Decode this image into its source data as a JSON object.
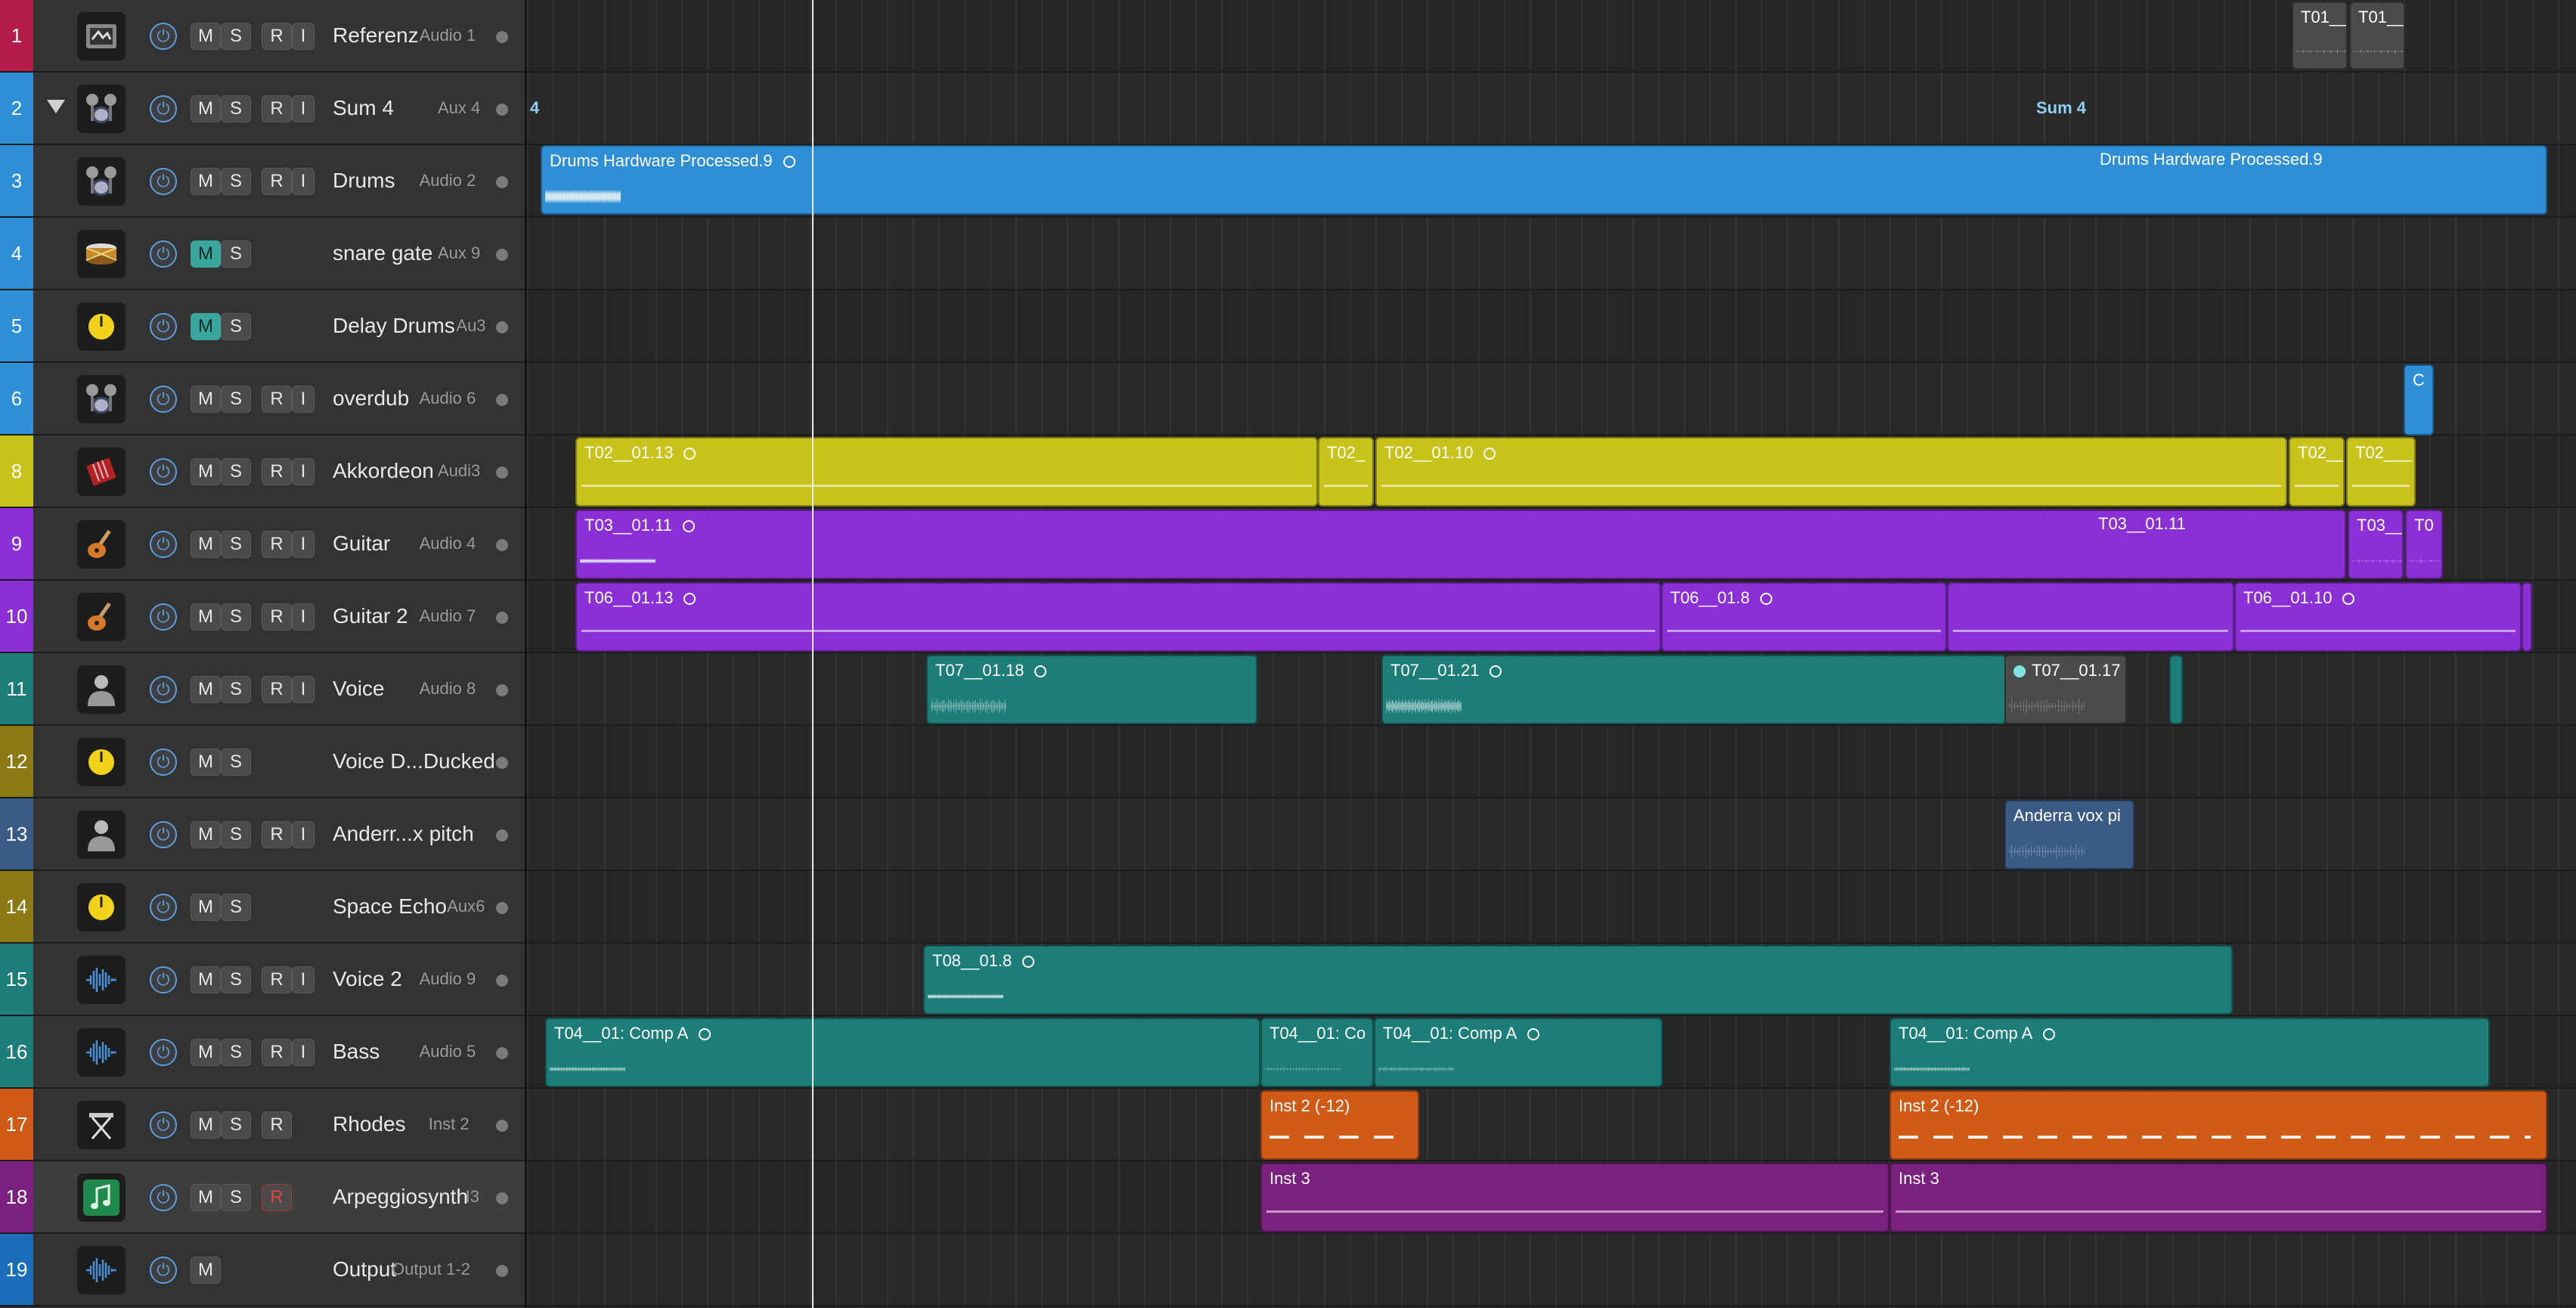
{
  "colors": {
    "blue": "#2f8fd6",
    "yellow": "#c8c31a",
    "purple": "#8b2fd6",
    "teal": "#1d7d78",
    "orange": "#cf5b17",
    "magenta": "#7a2180",
    "grey": "#4b4b4b",
    "slate": "#3a5b86"
  },
  "tracks": [
    {
      "num": "1",
      "name": "Referenz",
      "output": "Audio 1",
      "icon": "reference-icon",
      "strip": "#b31d4a",
      "buttons": [
        "M",
        "S",
        "R",
        "I"
      ]
    },
    {
      "num": "2",
      "name": "Sum 4",
      "output": "Aux 4",
      "icon": "drum-kit-icon",
      "strip": "#2f8fd6",
      "buttons": [
        "M",
        "S",
        "R",
        "I"
      ],
      "folder": true
    },
    {
      "num": "3",
      "name": "Drums",
      "output": "Audio 2",
      "icon": "drum-kit-icon",
      "strip": "#2f8fd6",
      "buttons": [
        "M",
        "S",
        "R",
        "I"
      ]
    },
    {
      "num": "4",
      "name": "snare gate",
      "output": "Aux 9",
      "icon": "snare-icon",
      "strip": "#2f8fd6",
      "buttons": [
        "M",
        "S"
      ],
      "mute_on": true
    },
    {
      "num": "5",
      "name": "Delay Drums",
      "output": "Au3",
      "icon": "aux-knob-icon",
      "strip": "#2f8fd6",
      "buttons": [
        "M",
        "S"
      ],
      "mute_on": true
    },
    {
      "num": "6",
      "name": "overdub",
      "output": "Audio 6",
      "icon": "drum-kit-icon",
      "strip": "#2f8fd6",
      "buttons": [
        "M",
        "S",
        "R",
        "I"
      ]
    },
    {
      "num": "8",
      "name": "Akkordeon",
      "output": "Audi3",
      "icon": "accordion-icon",
      "strip": "#c8c31a",
      "buttons": [
        "M",
        "S",
        "R",
        "I"
      ]
    },
    {
      "num": "9",
      "name": "Guitar",
      "output": "Audio 4",
      "icon": "guitar-icon",
      "strip": "#8b2fd6",
      "buttons": [
        "M",
        "S",
        "R",
        "I"
      ]
    },
    {
      "num": "10",
      "name": "Guitar 2",
      "output": "Audio 7",
      "icon": "guitar-icon",
      "strip": "#8b2fd6",
      "buttons": [
        "M",
        "S",
        "R",
        "I"
      ]
    },
    {
      "num": "11",
      "name": "Voice",
      "output": "Audio 8",
      "icon": "singer-icon",
      "strip": "#1d7d78",
      "buttons": [
        "M",
        "S",
        "R",
        "I"
      ]
    },
    {
      "num": "12",
      "name": "Voice D...Ducked",
      "output": "",
      "icon": "aux-knob-icon",
      "strip": "#8c7a14",
      "buttons": [
        "M",
        "S"
      ]
    },
    {
      "num": "13",
      "name": "Anderr...x pitch",
      "output": "",
      "icon": "singer-icon",
      "strip": "#3a5b86",
      "buttons": [
        "M",
        "S",
        "R",
        "I"
      ]
    },
    {
      "num": "14",
      "name": "Space Echo",
      "output": "Aux6",
      "icon": "aux-knob-icon",
      "strip": "#8c7a14",
      "buttons": [
        "M",
        "S"
      ]
    },
    {
      "num": "15",
      "name": "Voice 2",
      "output": "Audio 9",
      "icon": "waveform-icon",
      "strip": "#1d7d78",
      "buttons": [
        "M",
        "S",
        "R",
        "I"
      ]
    },
    {
      "num": "16",
      "name": "Bass",
      "output": "Audio 5",
      "icon": "waveform-icon",
      "strip": "#1d7d78",
      "buttons": [
        "M",
        "S",
        "R",
        "I"
      ]
    },
    {
      "num": "17",
      "name": "Rhodes",
      "output": "Inst 2",
      "icon": "keyboard-stand-icon",
      "strip": "#cf5b17",
      "buttons": [
        "M",
        "S",
        "R"
      ]
    },
    {
      "num": "18",
      "name": "Arpeggiosynth",
      "output": "I3",
      "icon": "midi-note-icon",
      "strip": "#7a2180",
      "buttons": [
        "M",
        "S",
        "R"
      ],
      "rec_arm": true,
      "selected": true
    },
    {
      "num": "19",
      "name": "Output",
      "output": "Output 1-2",
      "icon": "waveform-icon",
      "strip": "#1a6db8",
      "buttons": [
        "M"
      ]
    }
  ],
  "summary": {
    "left": "4",
    "mid": "Sum 4"
  },
  "regions": [
    {
      "lane": 0,
      "label": "T01__",
      "color": "grey",
      "wave": "grey-wave"
    },
    {
      "lane": 0,
      "label": "T01__",
      "color": "grey",
      "wave": "grey-wave"
    },
    {
      "lane": 2,
      "label": "Drums Hardware Processed.9",
      "color": "blue",
      "wave": "drum-wave",
      "loop": true
    },
    {
      "lane": 2,
      "label": "Drums Hardware Processed.9",
      "color": "blue",
      "wave": "none",
      "loop": true
    },
    {
      "lane": 5,
      "label": "C",
      "color": "blue",
      "wave": "none"
    },
    {
      "lane": 6,
      "label": "T02__01.13",
      "color": "yellow",
      "wave": "flat",
      "loop": true
    },
    {
      "lane": 6,
      "label": "T02_",
      "color": "yellow",
      "wave": "flat"
    },
    {
      "lane": 6,
      "label": "T02__01.10",
      "color": "yellow",
      "wave": "flat",
      "loop": true
    },
    {
      "lane": 6,
      "label": "T02__",
      "color": "yellow",
      "wave": "flat"
    },
    {
      "lane": 6,
      "label": "T02___",
      "color": "yellow",
      "wave": "flat"
    },
    {
      "lane": 7,
      "label": "T03__01.11",
      "color": "purple",
      "wave": "thin",
      "loop": true
    },
    {
      "lane": 7,
      "label": "T03__01.11",
      "color": "purple",
      "wave": "none",
      "loop": true
    },
    {
      "lane": 7,
      "label": "T03__",
      "color": "purple",
      "wave": "thin"
    },
    {
      "lane": 7,
      "label": "T0",
      "color": "purple",
      "wave": "thin"
    },
    {
      "lane": 8,
      "label": "T06__01.13",
      "color": "purple",
      "wave": "flat",
      "loop": true
    },
    {
      "lane": 8,
      "label": "T06__01.8",
      "color": "purple",
      "wave": "flat",
      "loop": true
    },
    {
      "lane": 8,
      "label": "",
      "color": "purple",
      "wave": "flat"
    },
    {
      "lane": 8,
      "label": "T06__01.10",
      "color": "purple",
      "wave": "flat",
      "loop": true
    },
    {
      "lane": 8,
      "label": "",
      "color": "purple",
      "wave": "none"
    },
    {
      "lane": 9,
      "label": "T07__01.18",
      "color": "teal",
      "wave": "vocal",
      "loop": true
    },
    {
      "lane": 9,
      "label": "T07__01.21",
      "color": "teal",
      "wave": "vocal",
      "loop": true
    },
    {
      "lane": 9,
      "label": "T07__01.17",
      "color": "grey",
      "wave": "vocal-grey",
      "loop_filled": true
    },
    {
      "lane": 9,
      "label": "",
      "color": "teal",
      "wave": "none"
    },
    {
      "lane": 11,
      "label": "Anderra vox pi",
      "color": "slate",
      "wave": "vocal-blue"
    },
    {
      "lane": 13,
      "label": "T08__01.8",
      "color": "teal",
      "wave": "thin",
      "loop": true
    },
    {
      "lane": 14,
      "label": "T04__01: Comp A",
      "color": "teal",
      "wave": "thin",
      "loop": true
    },
    {
      "lane": 14,
      "label": "T04__01: Co",
      "color": "teal",
      "wave": "thin"
    },
    {
      "lane": 14,
      "label": "T04__01: Comp A",
      "color": "teal",
      "wave": "thin",
      "loop": true
    },
    {
      "lane": 14,
      "label": "T04__01: Comp A",
      "color": "teal",
      "wave": "thin",
      "loop": true
    },
    {
      "lane": 15,
      "label": "Inst 2 (-12)",
      "color": "orange",
      "wave": "midi"
    },
    {
      "lane": 15,
      "label": "Inst 2 (-12)",
      "color": "orange",
      "wave": "midi"
    },
    {
      "lane": 16,
      "label": "Inst 3",
      "color": "magenta",
      "wave": "flat"
    },
    {
      "lane": 16,
      "label": "Inst 3",
      "color": "magenta",
      "wave": "flat"
    }
  ]
}
